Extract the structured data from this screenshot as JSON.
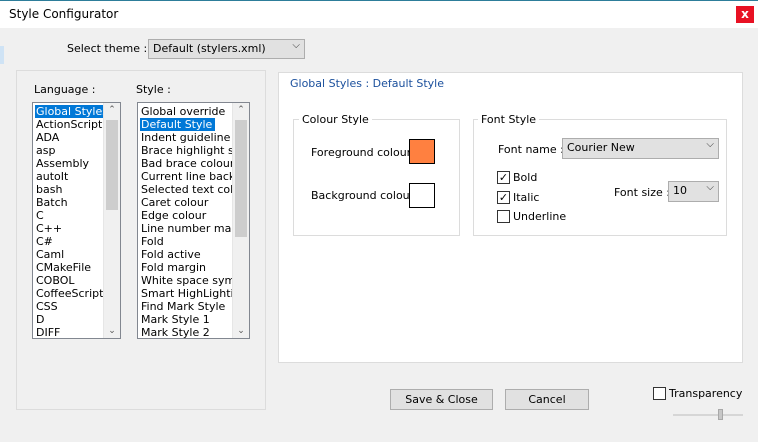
{
  "window": {
    "title": "Style Configurator",
    "close_glyph": "x"
  },
  "theme": {
    "label": "Select theme :",
    "value": "Default (stylers.xml)"
  },
  "language": {
    "label": "Language :",
    "items": [
      "Global Styles",
      "ActionScript",
      "ADA",
      "asp",
      "Assembly",
      "autoIt",
      "bash",
      "Batch",
      "C",
      "C++",
      "C#",
      "Caml",
      "CMakeFile",
      "COBOL",
      "CoffeeScript",
      "CSS",
      "D",
      "DIFF"
    ],
    "selected_index": 0
  },
  "style": {
    "label": "Style :",
    "items": [
      "Global override",
      "Default Style",
      "Indent guideline sty",
      "Brace highlight style",
      "Bad brace colour",
      "Current line backgr",
      "Selected text colour",
      "Caret colour",
      "Edge colour",
      "Line number margin",
      "Fold",
      "Fold active",
      "Fold margin",
      "White space symbo",
      "Smart HighLighting",
      "Find Mark Style",
      "Mark Style 1",
      "Mark Style 2"
    ],
    "selected_index": 1
  },
  "heading": "Global Styles : Default Style",
  "colour_style": {
    "title": "Colour Style",
    "fg_label": "Foreground colour",
    "bg_label": "Background colour",
    "fg_color": "#ff8040",
    "bg_color": "#ffffff"
  },
  "font_style": {
    "title": "Font Style",
    "name_label": "Font name :",
    "name_value": "Courier New",
    "size_label": "Font size :",
    "size_value": "10",
    "bold_label": "Bold",
    "italic_label": "Italic",
    "underline_label": "Underline",
    "bold_checked": true,
    "italic_checked": true,
    "underline_checked": false
  },
  "buttons": {
    "save": "Save & Close",
    "cancel": "Cancel"
  },
  "transparency": {
    "label": "Transparency",
    "checked": false
  },
  "glyphs": {
    "chevron": "⌵",
    "up": "⌃",
    "down": "⌄",
    "check": "✓"
  }
}
